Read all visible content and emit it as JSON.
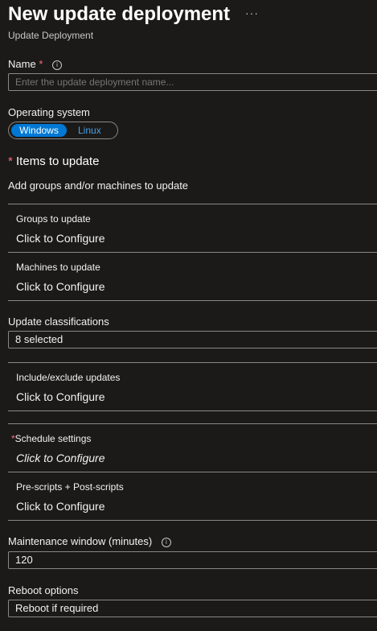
{
  "header": {
    "title": "New update deployment",
    "subtitle": "Update Deployment",
    "more_label": "···"
  },
  "name_field": {
    "label": "Name",
    "required_mark": "*",
    "placeholder": "Enter the update deployment name..."
  },
  "os": {
    "label": "Operating system",
    "options": [
      "Windows",
      "Linux"
    ],
    "selected": "Windows"
  },
  "items_to_update": {
    "required_mark": "*",
    "title": "Items to update",
    "description": "Add groups and/or machines to update",
    "groups": {
      "label": "Groups to update",
      "value": "Click to Configure"
    },
    "machines": {
      "label": "Machines to update",
      "value": "Click to Configure"
    }
  },
  "classifications": {
    "label": "Update classifications",
    "value": "8 selected"
  },
  "include_exclude": {
    "label": "Include/exclude updates",
    "value": "Click to Configure"
  },
  "schedule": {
    "required_mark": "*",
    "label": "Schedule settings",
    "value": "Click to Configure"
  },
  "scripts": {
    "label": "Pre-scripts + Post-scripts",
    "value": "Click to Configure"
  },
  "maintenance": {
    "label": "Maintenance window (minutes)",
    "value": "120"
  },
  "reboot": {
    "label": "Reboot options",
    "value": "Reboot if required"
  },
  "icons": {
    "info": "info-icon",
    "more": "more-icon"
  }
}
